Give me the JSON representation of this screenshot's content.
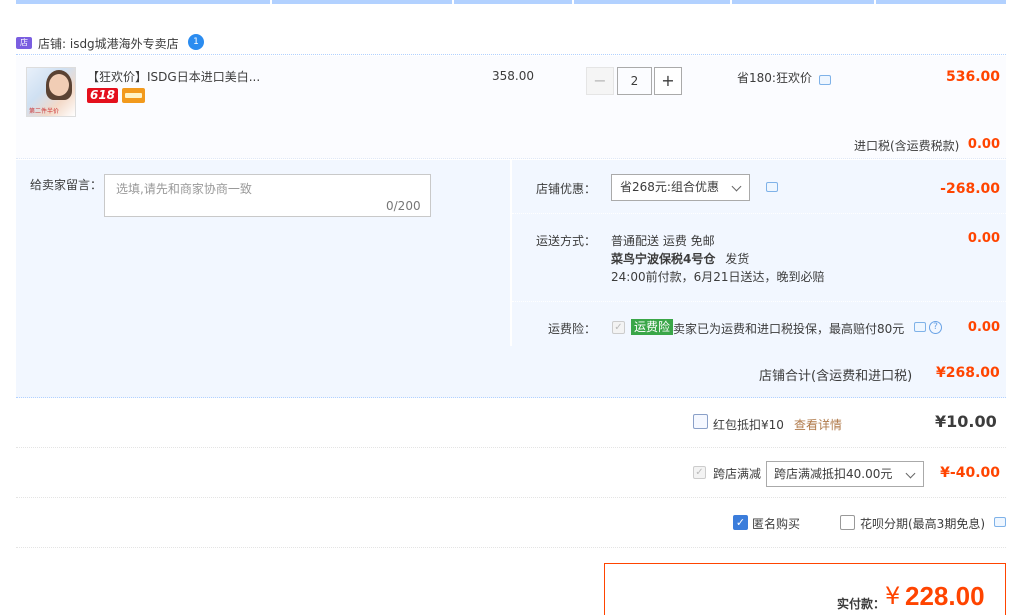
{
  "store": {
    "label": "店铺: isdg城港海外专卖店",
    "badge": "1"
  },
  "item": {
    "thumb_caption": "第二件半价",
    "title": "【狂欢价】ISDG日本进口美白...",
    "tag_618": "618",
    "price": "358.00",
    "quantity": "2",
    "qty_minus": "−",
    "qty_plus": "+",
    "promo": "省180:狂欢价",
    "subtotal": "536.00",
    "tax_label": "进口税(含运费税款)",
    "tax_value": "0.00"
  },
  "memo": {
    "label": "给卖家留言：",
    "placeholder": "选填,请先和商家协商一致",
    "count": "0/200"
  },
  "shop_discount": {
    "label": "店铺优惠：",
    "selected": "省268元:组合优惠",
    "value": "-268.00"
  },
  "shipping": {
    "label": "运送方式：",
    "line1": "普通配送 运费 免邮",
    "line2_bold": "菜鸟宁波保税4号仓",
    "line2_rest": "发货",
    "line3": "24:00前付款，6月21日送达，晚到必赔",
    "value": "0.00"
  },
  "insurance": {
    "label": "运费险：",
    "tag": "运费险",
    "text": "卖家已为运费和进口税投保，最高赔付80元",
    "help": "?",
    "value": "0.00"
  },
  "store_total": {
    "label": "店铺合计(含运费和进口税)",
    "value": "¥268.00"
  },
  "red_packet": {
    "label": "红包抵扣¥10",
    "link": "查看详情",
    "value": "¥10.00"
  },
  "cross_store": {
    "label": "跨店满减",
    "selected": "跨店满减抵扣40.00元",
    "value": "¥-40.00"
  },
  "options": {
    "anonymous": "匿名购买",
    "huabei": "花呗分期(最高3期免息)"
  },
  "pay": {
    "label": "实付款：",
    "currency": "¥",
    "amount": "228.00"
  },
  "colors": {
    "accent_red": "#ff4400",
    "blue_border": "#b2d1ff",
    "pane_bg": "#f2f7ff",
    "green_tag": "#3aa648"
  },
  "icons": [
    "store-icon",
    "chat-icon",
    "chevron-down-icon",
    "help-icon",
    "card-icon"
  ]
}
